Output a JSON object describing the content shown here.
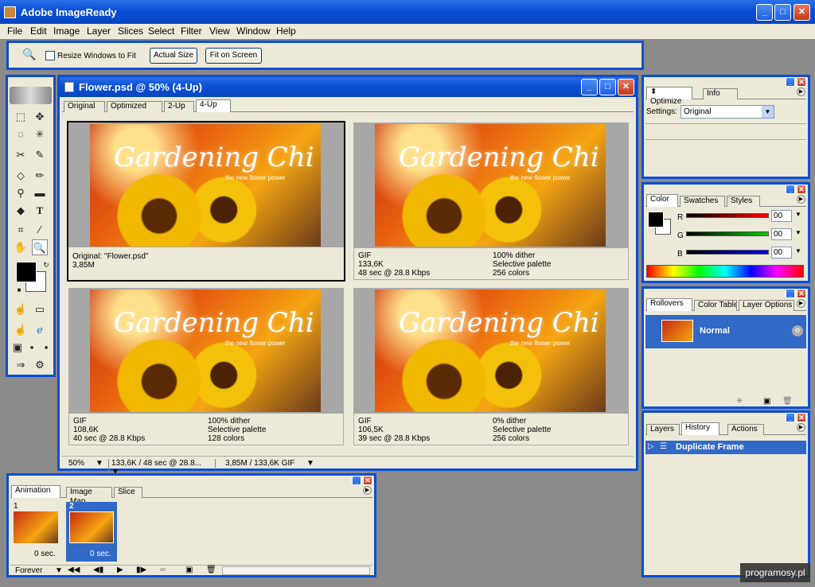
{
  "app": {
    "title": "Adobe ImageReady"
  },
  "menu": [
    "File",
    "Edit",
    "Image",
    "Layer",
    "Slices",
    "Select",
    "Filter",
    "View",
    "Window",
    "Help"
  ],
  "options": {
    "resize": "Resize Windows to Fit",
    "actual": "Actual Size",
    "fit": "Fit on Screen"
  },
  "doc": {
    "title": "Flower.psd @ 50% (4-Up)",
    "tabs": [
      "Original",
      "Optimized",
      "2-Up",
      "4-Up"
    ],
    "script": "Gardening Chi",
    "tagline": "the new flower power",
    "views": [
      {
        "col1": [
          "Original: \"Flower.psd\"",
          "3,85M",
          ""
        ],
        "col2": [
          "",
          "",
          ""
        ]
      },
      {
        "col1": [
          "GIF",
          "133,6K",
          "48 sec @ 28.8 Kbps"
        ],
        "col2": [
          "100% dither",
          "Selective palette",
          "256 colors"
        ]
      },
      {
        "col1": [
          "GIF",
          "108,6K",
          "40 sec @ 28.8 Kbps"
        ],
        "col2": [
          "100% dither",
          "Selective palette",
          "128 colors"
        ]
      },
      {
        "col1": [
          "GIF",
          "106,5K",
          "39 sec @ 28.8 Kbps"
        ],
        "col2": [
          "0% dither",
          "Selective palette",
          "256 colors"
        ]
      }
    ],
    "status": {
      "zoom": "50%",
      "info1": "133,6K / 48 sec @ 28.8...",
      "info2": "3,85M / 133,6K GIF"
    }
  },
  "optimize": {
    "tabs": [
      "Optimize",
      "Info"
    ],
    "settings_label": "Settings:",
    "settings_value": "Original"
  },
  "color": {
    "tabs": [
      "Color",
      "Swatches",
      "Styles"
    ],
    "r_label": "R",
    "g_label": "G",
    "b_label": "B",
    "r": "00",
    "g": "00",
    "b": "00"
  },
  "rollovers": {
    "tabs": [
      "Rollovers",
      "Color Table",
      "Layer Options"
    ],
    "state": "Normal"
  },
  "history": {
    "tabs": [
      "Layers",
      "History",
      "Actions"
    ],
    "item": "Duplicate Frame"
  },
  "animation": {
    "tabs": [
      "Animation",
      "Image Map",
      "Slice"
    ],
    "frames": [
      {
        "num": "1",
        "delay": "0 sec."
      },
      {
        "num": "2",
        "delay": "0 sec."
      }
    ],
    "loop": "Forever"
  },
  "watermark": "programosy.pl"
}
